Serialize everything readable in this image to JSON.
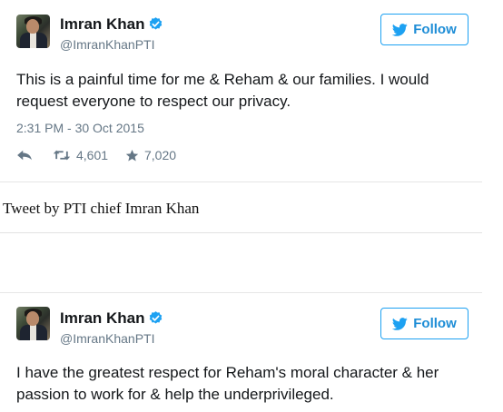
{
  "tweets": [
    {
      "author": {
        "name": "Imran Khan",
        "handle": "@ImranKhanPTI",
        "verified": true
      },
      "follow_label": "Follow",
      "text": [
        "This is a painful time for me & Reham & our families. I would",
        "request everyone to respect our privacy."
      ],
      "timestamp": "2:31 PM - 30 Oct 2015",
      "retweets": "4,601",
      "likes": "7,020"
    },
    {
      "author": {
        "name": "Imran Khan",
        "handle": "@ImranKhanPTI",
        "verified": true
      },
      "follow_label": "Follow",
      "text": [
        "I have the greatest respect for Reham's moral character & her",
        "passion to work for & help the underprivileged."
      ]
    }
  ],
  "caption": "Tweet by PTI chief Imran Khan",
  "colors": {
    "accent": "#1da1f2",
    "muted": "#657786",
    "verified": "#1da1f2"
  }
}
